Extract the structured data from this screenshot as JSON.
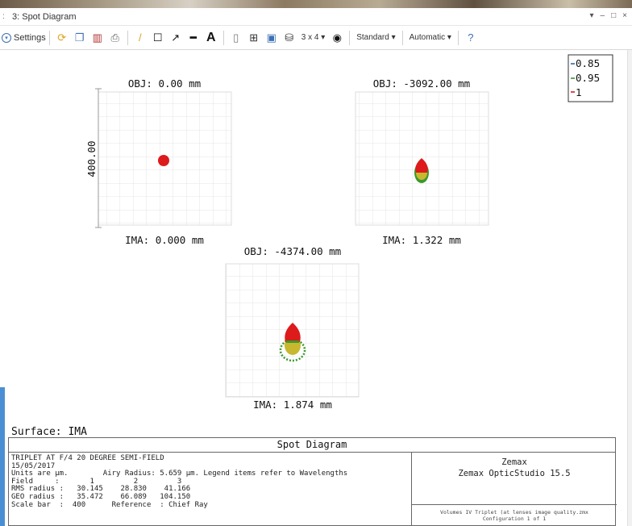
{
  "window": {
    "title": "3: Spot Diagram",
    "controls": [
      "▾",
      "–",
      "□",
      "×"
    ]
  },
  "toolbar": {
    "settings_label": "Settings",
    "layout_label": "3 x 4 ▾",
    "standard_label": "Standard ▾",
    "automatic_label": "Automatic ▾"
  },
  "plots": [
    {
      "obj": "OBJ: 0.00 mm",
      "ima": "IMA: 0.000 mm",
      "scale_label": "400.00"
    },
    {
      "obj": "OBJ: -3092.00 mm",
      "ima": "IMA: 1.322 mm"
    },
    {
      "obj": "OBJ: -4374.00 mm",
      "ima": "IMA: 1.874 mm"
    }
  ],
  "legend": {
    "items": [
      {
        "label": "0.85",
        "color": "#1f5aa8"
      },
      {
        "label": "0.95",
        "color": "#2e8b2e"
      },
      {
        "label": "1",
        "color": "#cc1111"
      }
    ]
  },
  "colors": {
    "red": "#dd1b1b",
    "green": "#3a9a2a",
    "yellow": "#c8b830",
    "accent": "#4a8fd4"
  },
  "surface_label": "Surface: IMA",
  "info": {
    "header": "Spot Diagram",
    "lines": [
      "TRIPLET AT F/4 20 DEGREE SEMI-FIELD",
      "15/05/2017",
      "Units are µm.        Airy Radius: 5.659 µm. Legend items refer to Wavelengths",
      "Field     :       1         2         3",
      "RMS radius :   30.145    28.830    41.166",
      "GEO radius :   35.472    66.089   104.150",
      "Scale bar  :  400      Reference  : Chief Ray"
    ],
    "product_line1": "Zemax",
    "product_line2": "Zemax OpticStudio 15.5",
    "file_line": "Volumes IV Triplet (at lenses image quality.zmx",
    "config_line": "Configuration 1 of 1"
  }
}
